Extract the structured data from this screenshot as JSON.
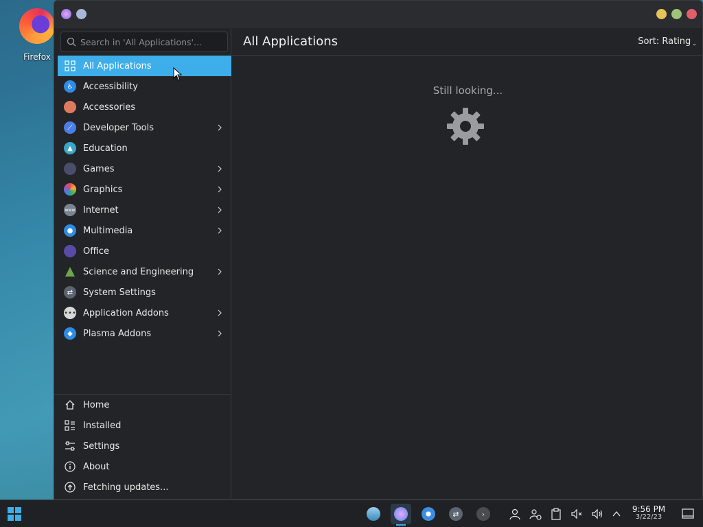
{
  "desktop": {
    "icons": [
      {
        "label": "Firefox"
      }
    ]
  },
  "window": {
    "search": {
      "placeholder": "Search in 'All Applications'..."
    },
    "categories": [
      {
        "label": "All Applications",
        "icon": "grid-icon",
        "color": "#3daee9",
        "submenu": false,
        "active": true
      },
      {
        "label": "Accessibility",
        "icon": "accessibility-icon",
        "color": "#2d8ce6",
        "submenu": false
      },
      {
        "label": "Accessories",
        "icon": "accessories-icon",
        "color": "#e07a5f",
        "submenu": false
      },
      {
        "label": "Developer Tools",
        "icon": "developer-tools-icon",
        "color": "#4a7ee8",
        "submenu": true
      },
      {
        "label": "Education",
        "icon": "education-icon",
        "color": "#3aa6c9",
        "submenu": false
      },
      {
        "label": "Games",
        "icon": "games-icon",
        "color": "#4a4e6a",
        "submenu": true
      },
      {
        "label": "Graphics",
        "icon": "graphics-icon",
        "color": "#c94fa0",
        "submenu": true
      },
      {
        "label": "Internet",
        "icon": "internet-icon",
        "color": "#7a8490",
        "submenu": true
      },
      {
        "label": "Multimedia",
        "icon": "multimedia-icon",
        "color": "#2d8ce6",
        "submenu": true
      },
      {
        "label": "Office",
        "icon": "office-icon",
        "color": "#5a4aa8",
        "submenu": false
      },
      {
        "label": "Science and Engineering",
        "icon": "science-icon",
        "color": "#6aa84a",
        "submenu": true
      },
      {
        "label": "System Settings",
        "icon": "system-settings-icon",
        "color": "#5c6470",
        "submenu": false
      },
      {
        "label": "Application Addons",
        "icon": "addons-icon",
        "color": "#d8d8d8",
        "submenu": true
      },
      {
        "label": "Plasma Addons",
        "icon": "plasma-addons-icon",
        "color": "#2d8ce6",
        "submenu": true
      }
    ],
    "bottom_items": [
      {
        "label": "Home",
        "icon": "home-icon"
      },
      {
        "label": "Installed",
        "icon": "installed-icon"
      },
      {
        "label": "Settings",
        "icon": "settings-sliders-icon"
      },
      {
        "label": "About",
        "icon": "info-icon"
      },
      {
        "label": "Fetching updates...",
        "icon": "update-icon"
      }
    ],
    "header": {
      "title": "All Applications",
      "sort_label": "Sort: Rating"
    },
    "status": {
      "text": "Still looking..."
    }
  },
  "taskbar": {
    "clock": {
      "time": "9:56 PM",
      "date": "3/22/23"
    }
  },
  "colors": {
    "accent": "#3daee9",
    "window_bg": "#232427",
    "taskbar_bg": "#1f2124"
  }
}
